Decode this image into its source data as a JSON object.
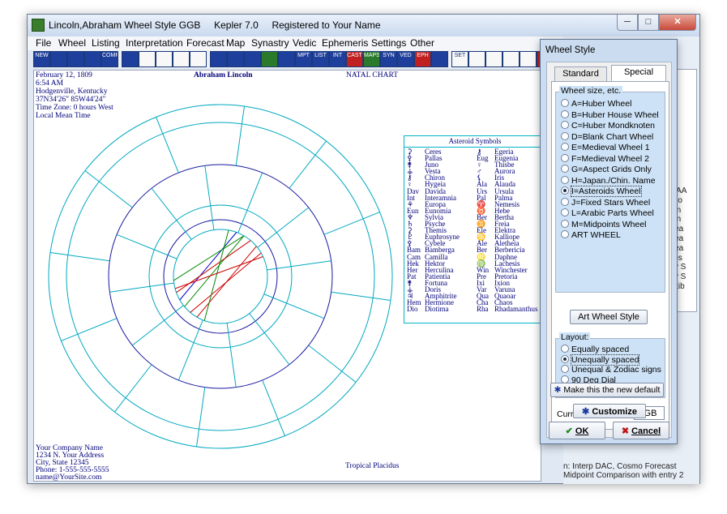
{
  "window": {
    "title": "Lincoln,Abraham Wheel Style GGB     Kepler 7.0     Registered to Your Name",
    "min_label": "─",
    "max_label": "□",
    "close_label": "✕"
  },
  "menu": [
    "File",
    "Wheel",
    "Listing",
    "Interpretation",
    "Forecast",
    "Map",
    "Synastry",
    "Vedic",
    "Ephemeris",
    "Settings",
    "Other"
  ],
  "toolbar": [
    "NEW",
    "",
    "",
    "",
    "COMP",
    "",
    "",
    "",
    "",
    "",
    "",
    "",
    "",
    "",
    "",
    "MPT",
    "LIST",
    "INT",
    "CAST",
    "MAPS",
    "SYN",
    "VED",
    "EPH",
    "",
    "SET",
    "",
    "",
    "",
    "",
    ""
  ],
  "chart": {
    "birth_date": "February 12, 1809",
    "birth_time": "6:54 AM",
    "birth_place": "Hodgenville, Kentucky",
    "coords": "37N34'26\"  85W44'24\"",
    "time_zone": "Time Zone: 0 hours West",
    "local_time": "Local Mean Time",
    "name": "Abraham Lincoln",
    "chart_type": "NATAL CHART",
    "house_system": "Tropical Placidus",
    "company": [
      "Your Company Name",
      "1234 N. Your Address",
      "City, State 12345",
      "Phone: 1-555-555-5555",
      "name@YourSite.com"
    ]
  },
  "asteroid_table": {
    "title": "Asteroid Symbols",
    "left": [
      [
        "⚳",
        "Ceres"
      ],
      [
        "⚴",
        "Pallas"
      ],
      [
        "⚵",
        "Juno"
      ],
      [
        "⚶",
        "Vesta"
      ],
      [
        "⚷",
        "Chiron"
      ],
      [
        "♀",
        "Hygeia"
      ],
      [
        "Dav",
        "Davida"
      ],
      [
        "Int",
        "Interamnia"
      ],
      [
        "⚘",
        "Europa"
      ],
      [
        "Eun",
        "Eunomia"
      ],
      [
        "♆",
        "Sylvia"
      ],
      [
        "♄",
        "Psyche"
      ],
      [
        "⚳",
        "Themis"
      ],
      [
        "♇",
        "Euphrosyne"
      ],
      [
        "⚴",
        "Cybele"
      ],
      [
        "Bam",
        "Bamberga"
      ],
      [
        "Cam",
        "Camilla"
      ],
      [
        "Hek",
        "Hektor"
      ],
      [
        "Her",
        "Herculina"
      ],
      [
        "Pat",
        "Patientia"
      ],
      [
        "⚵",
        "Fortuna"
      ],
      [
        "⚶",
        "Doris"
      ],
      [
        "♃",
        "Amphitrite"
      ],
      [
        "Hem",
        "Hermione"
      ],
      [
        "Dio",
        "Diotima"
      ]
    ],
    "right": [
      [
        "⚷",
        "Egeria"
      ],
      [
        "Eug",
        "Eugenia"
      ],
      [
        "♀",
        "Thisbe"
      ],
      [
        "♂",
        "Aurora"
      ],
      [
        "⚸",
        "Iris"
      ],
      [
        "Ala",
        "Alauda"
      ],
      [
        "Urs",
        "Ursula"
      ],
      [
        "Pal",
        "Palma"
      ],
      [
        "♈",
        "Nemesis"
      ],
      [
        "♉",
        "Hebe"
      ],
      [
        "Ber",
        "Bertha"
      ],
      [
        "♊",
        "Freia"
      ],
      [
        "Ele",
        "Elektra"
      ],
      [
        "♋",
        "Kalliope"
      ],
      [
        "Ale",
        "Aletheia"
      ],
      [
        "Ber",
        "Berbericia"
      ],
      [
        "♌",
        "Daphne"
      ],
      [
        "♍",
        "Lachesis"
      ],
      [
        "Win",
        "Winchester"
      ],
      [
        "Pre",
        "Pretoria"
      ],
      [
        "Ixi",
        "Ixion"
      ],
      [
        "Var",
        "Varuna"
      ],
      [
        "Qua",
        "Quaoar"
      ],
      [
        "Cha",
        "Chaos"
      ],
      [
        "Rha",
        "Rhadamanthus"
      ]
    ]
  },
  "dialog": {
    "title": "Wheel Style",
    "tabs": [
      "Standard",
      "Special"
    ],
    "size_group": "Wheel size, etc.",
    "size_options": [
      "A=Huber Wheel",
      "B=Huber House Wheel",
      "C=Huber Mondknoten",
      "D=Blank Chart Wheel",
      "E=Medieval Wheel 1",
      "F=Medieval Wheel 2",
      "G=Aspect Grids Only",
      "H=Japan./Chin. Name",
      "I=Asteroids Wheel",
      "J=Fixed Stars Wheel",
      "L=Arabic Parts Wheel",
      "M=Midpoints Wheel",
      "ART WHEEL"
    ],
    "size_selected": 8,
    "art_button": "Art Wheel Style",
    "layout_group": "Layout:",
    "layout_options": [
      "Equally spaced",
      "Unequally spaced",
      "Unequal & Zodiac signs",
      "90 Deg Dial",
      "Square Wheel"
    ],
    "layout_selected": 1,
    "current_label": "Current Wheel Style:",
    "current_value": "GGB",
    "default_button": "Make this the new default",
    "customize_button": "Customize",
    "ok_button": "OK",
    "cancel_button": "Cancel"
  },
  "background_text": [
    "1) AA",
    "- Co",
    "turn",
    "turn",
    "-Yea",
    "-Yea",
    "-Yea",
    "mes",
    "ory S",
    "ory S",
    "patib",
    "n: Interp DAC, Cosmo Forecast",
    "Midpoint Comparison  with entry 2"
  ],
  "colors": {
    "accent": "#00007a",
    "wheel_line": "#00a8c0",
    "aspect_red": "#cc0000",
    "aspect_green": "#008800",
    "aspect_blue": "#0000cc"
  }
}
